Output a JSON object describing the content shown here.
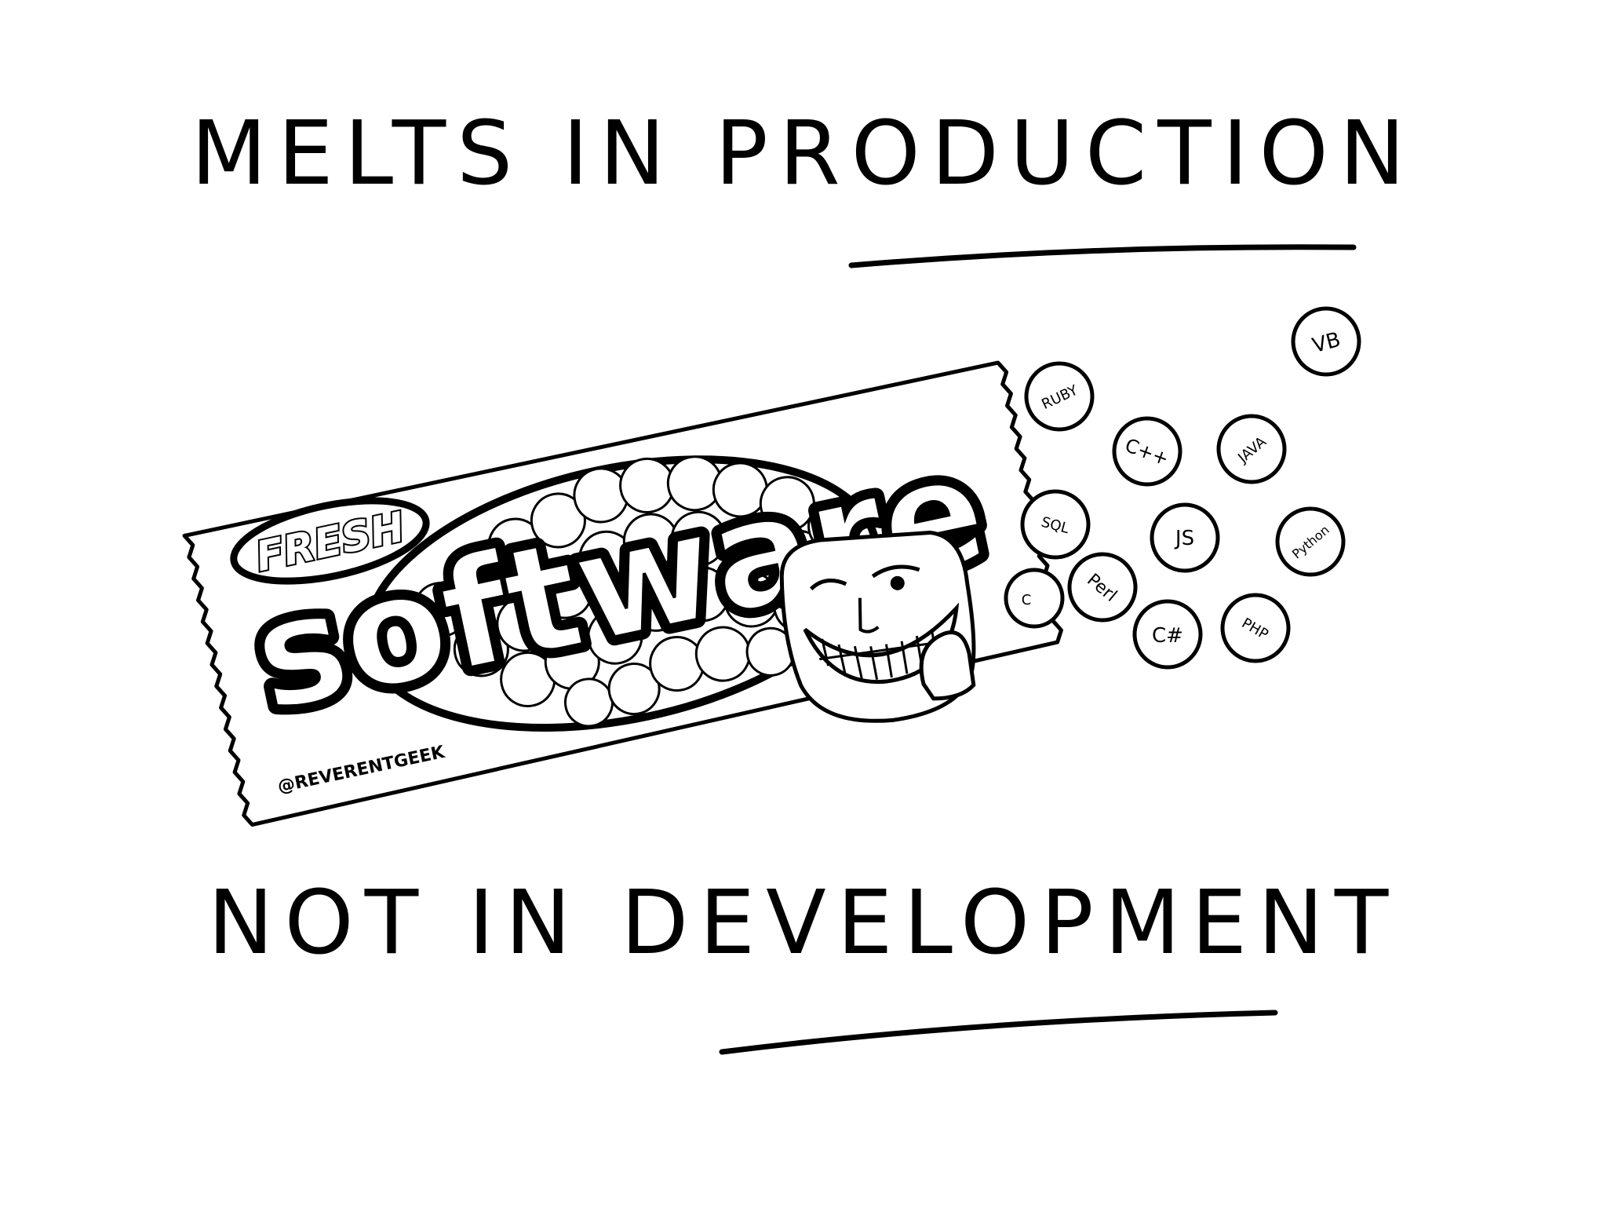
{
  "headline_top": {
    "prefix": "MELTS IN",
    "emphasis": "PRODUCTION"
  },
  "headline_bottom": {
    "prefix": "NOT IN",
    "emphasis": "DEVELOPMENT"
  },
  "wrapper": {
    "badge": "FRESH",
    "brand": "software",
    "signature": "@REVERENTGEEK"
  },
  "candies": [
    {
      "label": "RUBY"
    },
    {
      "label": "VB"
    },
    {
      "label": "C++"
    },
    {
      "label": "JAVA"
    },
    {
      "label": "SQL"
    },
    {
      "label": "JS"
    },
    {
      "label": "Python"
    },
    {
      "label": "Perl"
    },
    {
      "label": "C#"
    },
    {
      "label": "PHP"
    },
    {
      "label": "C"
    }
  ],
  "colors": {
    "ink": "#000000",
    "paper": "#ffffff"
  }
}
